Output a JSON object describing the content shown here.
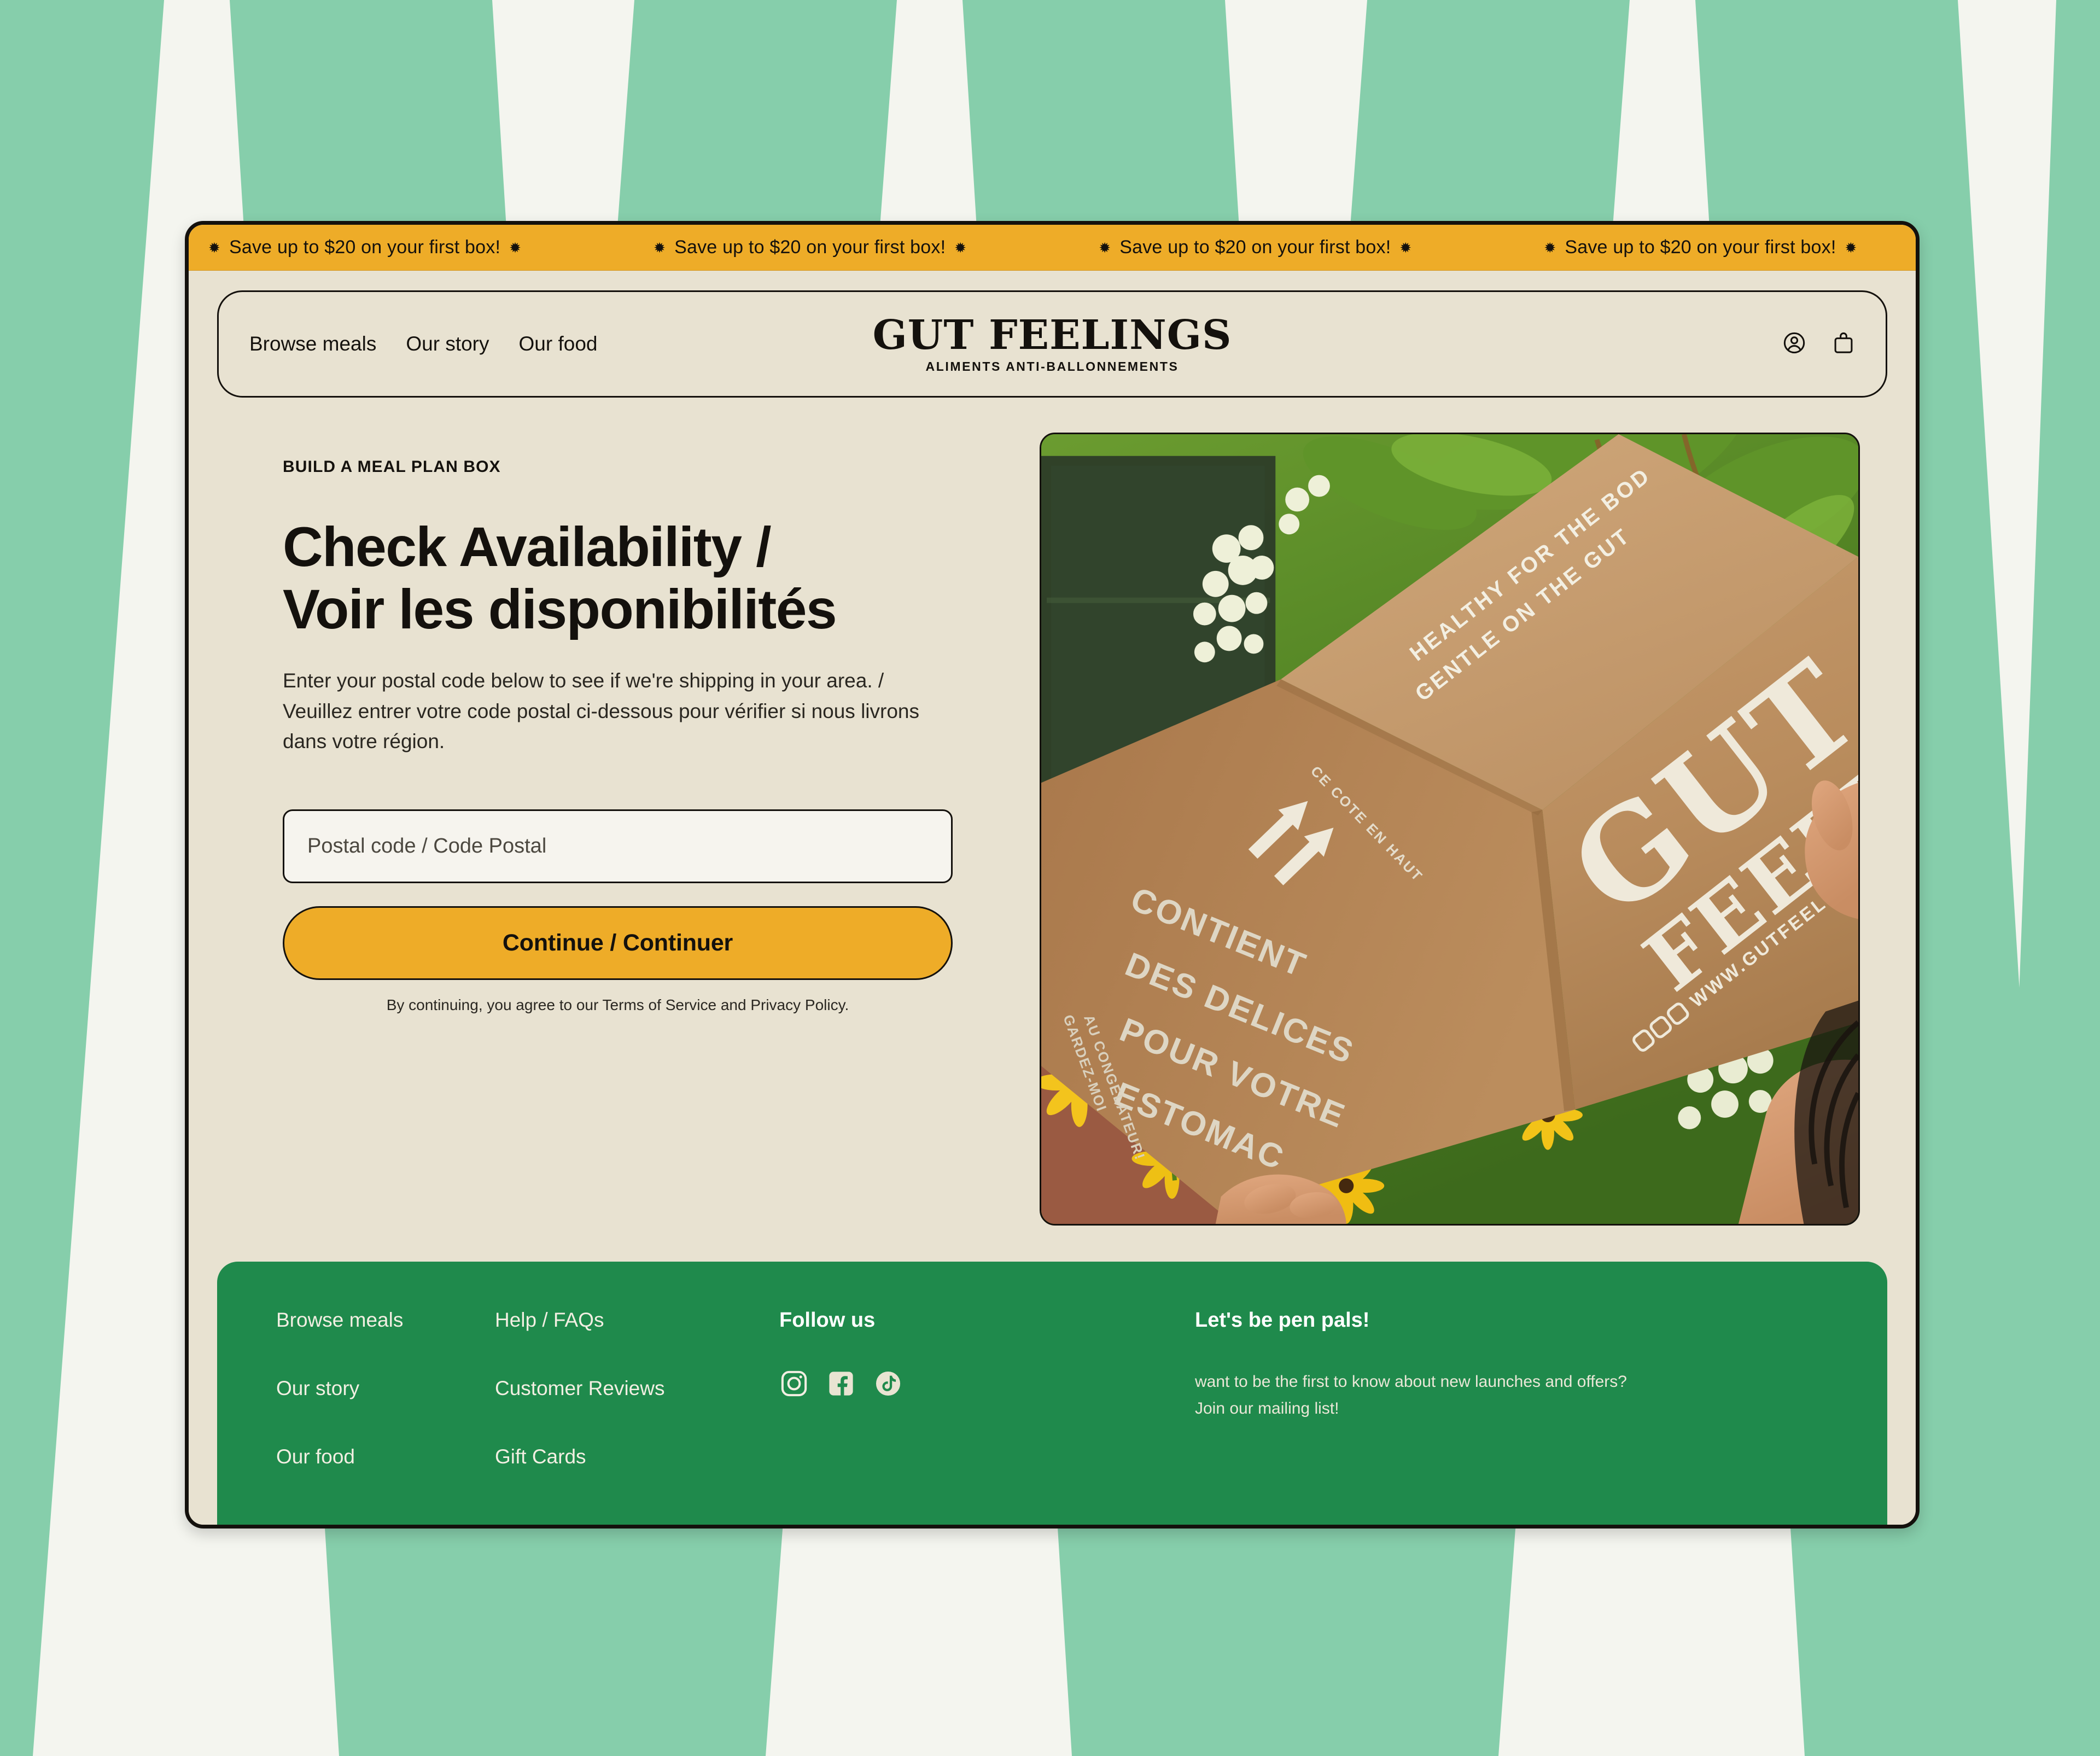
{
  "announcement": {
    "message": "Save up to $20 on your first box!",
    "burst_glyph": "✹",
    "repeat_count": 4,
    "background_color": "#eeac28"
  },
  "header": {
    "nav": [
      {
        "label": "Browse meals"
      },
      {
        "label": "Our story"
      },
      {
        "label": "Our food"
      }
    ],
    "brand": {
      "wordmark": "GUT FEELINGS",
      "tagline": "ALIMENTS ANTI-BALLONNEMENTS"
    },
    "actions": [
      {
        "icon": "account-icon"
      },
      {
        "icon": "cart-icon"
      }
    ]
  },
  "hero": {
    "eyebrow": "BUILD A MEAL PLAN BOX",
    "heading_line_1": "Check Availability /",
    "heading_line_2": "Voir les disponibilités",
    "description": "Enter your postal code below to see if we're shipping in your area. / Veuillez entrer votre code postal ci-dessous pour vérifier si nous livrons dans votre région.",
    "postal_placeholder": "Postal code / Code Postal",
    "postal_value": "",
    "continue_label": "Continue / Continuer",
    "terms_note": "By continuing, you agree to our Terms of Service and Privacy Policy.",
    "image": {
      "alt": "Hands holding a kraft cardboard Gut Feelings meal box in a garden with yellow rudbeckia and white hydrangea flowers",
      "box_text_top_line_1": "HEALTHY FOR THE BOD",
      "box_text_top_line_2": "GENTLE ON THE GUT",
      "box_text_logo_line_1": "GUT",
      "box_text_logo_line_2": "FEELINGS",
      "box_text_url": "WWW.GUTFEELINGS",
      "box_text_side_line_1": "CONTIENT",
      "box_text_side_line_2": "DES DELICES",
      "box_text_side_line_3": "POUR VOTRE",
      "box_text_side_line_4": "ESTOMAC",
      "box_text_flap_1": "CE COTE EN HAUT",
      "box_text_flap_2": "GARDEZ-MOI",
      "box_text_flap_3": "AU CONGELATEUR!"
    }
  },
  "footer": {
    "background_color": "#1f8a4c",
    "column_1": [
      {
        "label": "Browse meals"
      },
      {
        "label": "Our story"
      },
      {
        "label": "Our food"
      }
    ],
    "column_2": [
      {
        "label": "Help / FAQs"
      },
      {
        "label": "Customer Reviews"
      },
      {
        "label": "Gift Cards"
      }
    ],
    "social": {
      "heading": "Follow us",
      "items": [
        {
          "icon": "instagram-icon"
        },
        {
          "icon": "facebook-icon"
        },
        {
          "icon": "tiktok-icon"
        }
      ]
    },
    "newsletter": {
      "heading": "Let's be pen pals!",
      "body_line_1": "want to be the first to know about new launches and offers?",
      "body_line_2": "Join our mailing list!"
    }
  },
  "theme": {
    "cream": "#e8e2d1",
    "ink": "#14110d",
    "yellow": "#eeac28",
    "green": "#1f8a4c",
    "mint": "#86ceab",
    "off_white": "#f4f5ef"
  }
}
